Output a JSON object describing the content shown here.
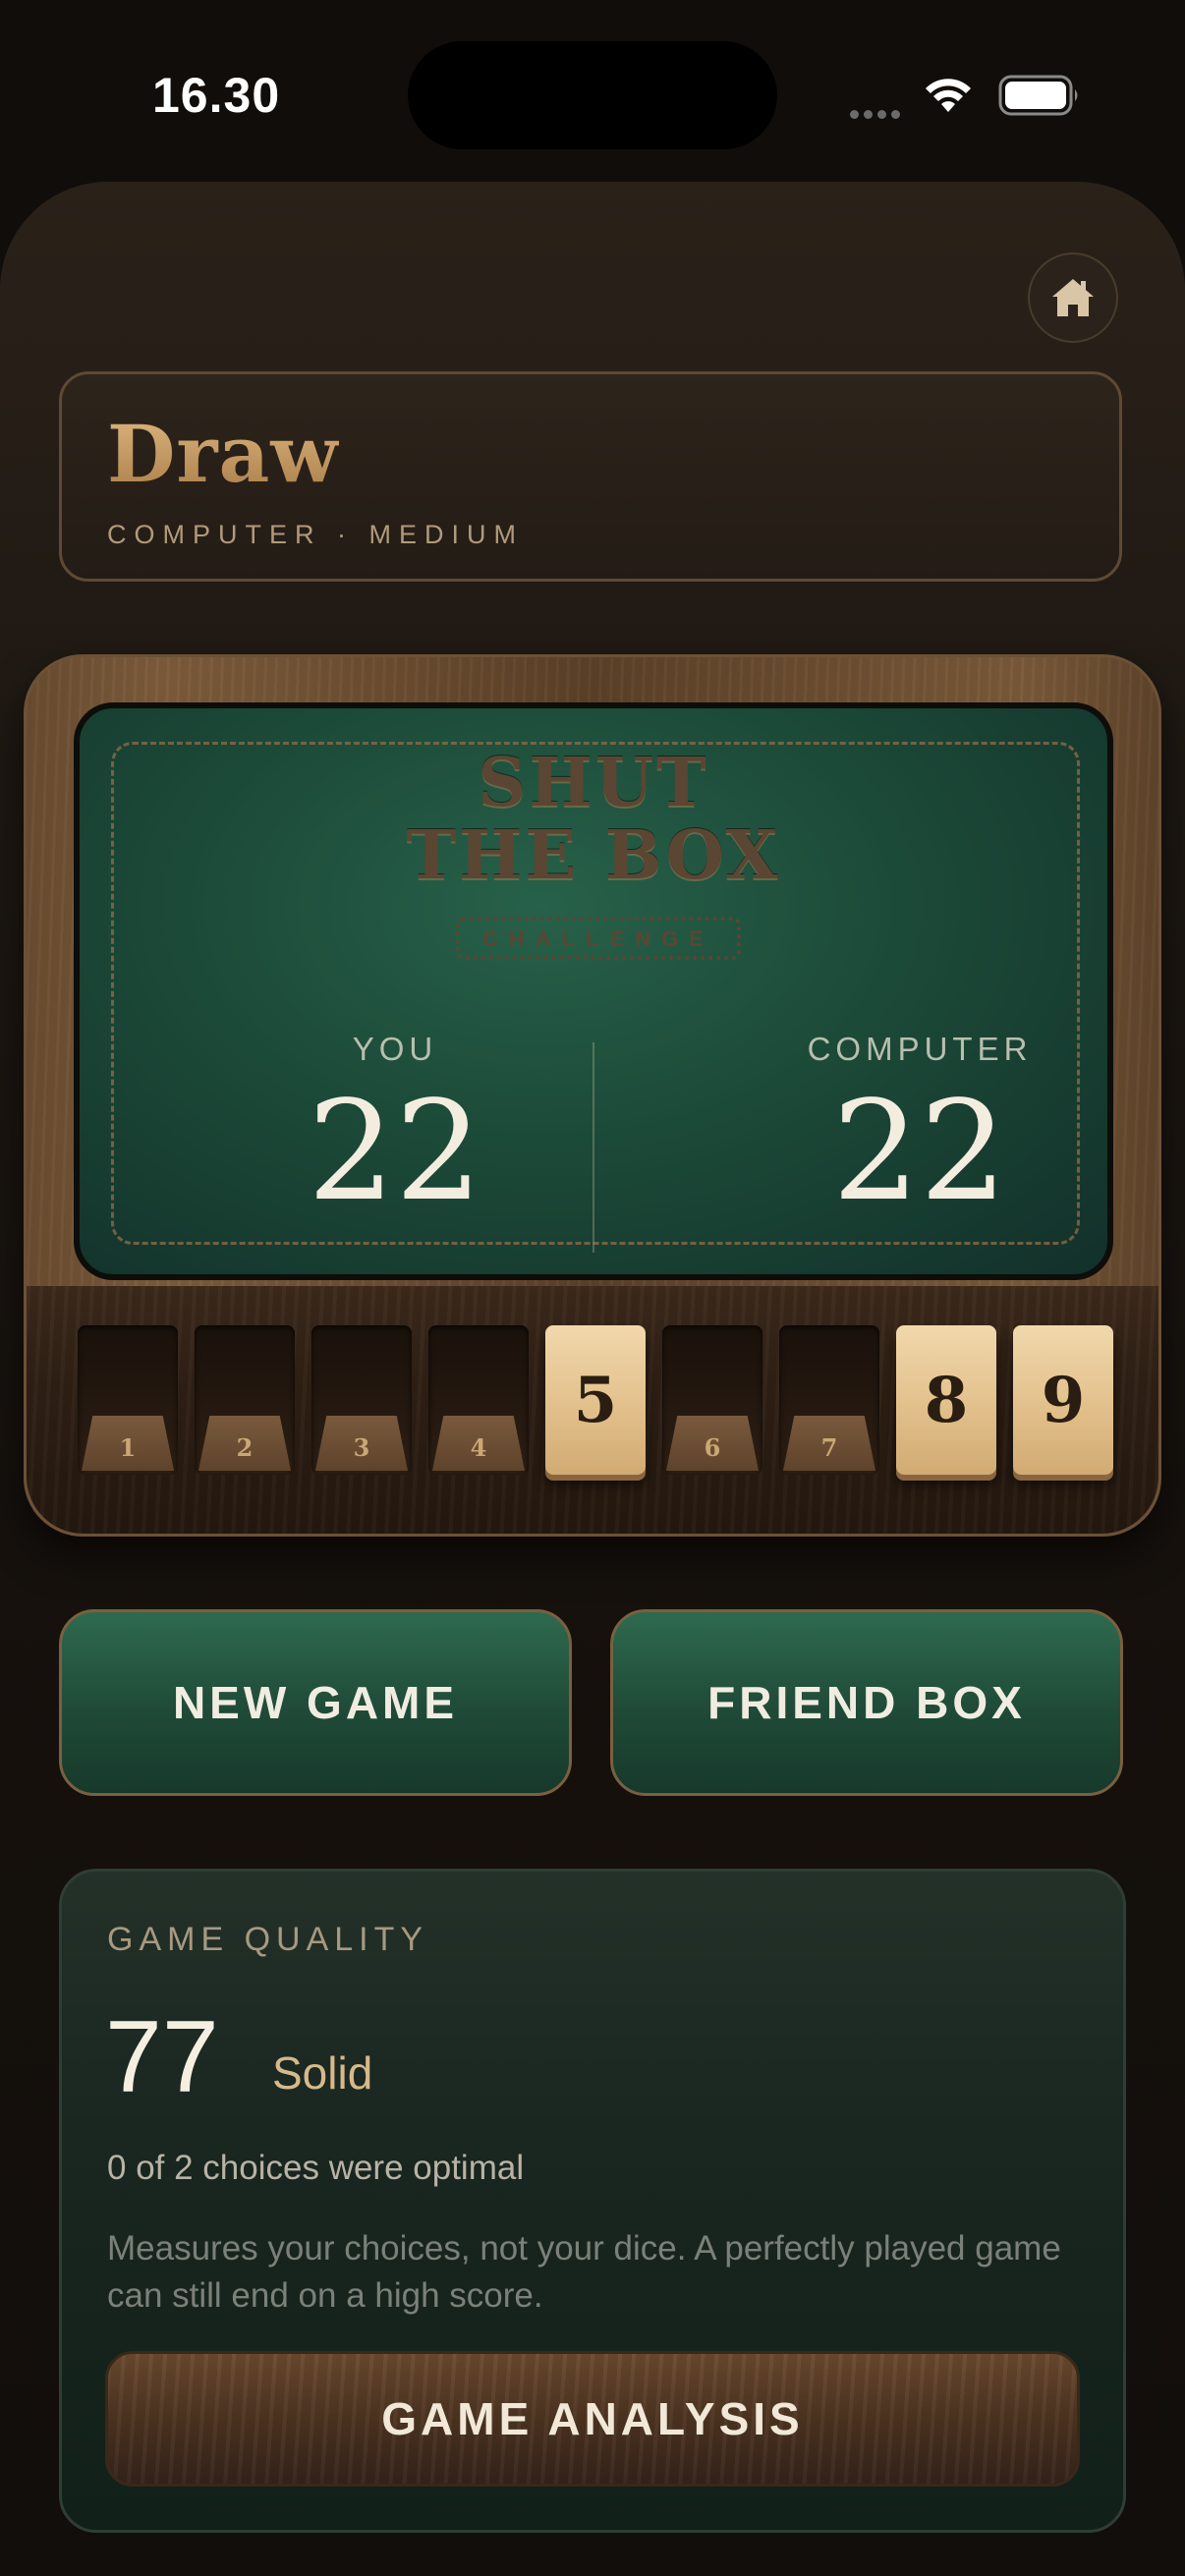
{
  "status_bar": {
    "time": "16.30"
  },
  "result": {
    "title": "Draw",
    "subtitle": "COMPUTER · MEDIUM"
  },
  "box": {
    "logo_line1": "SHUT",
    "logo_line2": "THE BOX",
    "logo_badge": "CHALLENGE",
    "players": [
      {
        "label": "YOU",
        "score": "22"
      },
      {
        "label": "COMPUTER",
        "score": "22"
      }
    ],
    "tiles": [
      {
        "number": "1",
        "state": "down"
      },
      {
        "number": "2",
        "state": "down"
      },
      {
        "number": "3",
        "state": "down"
      },
      {
        "number": "4",
        "state": "down"
      },
      {
        "number": "5",
        "state": "up"
      },
      {
        "number": "6",
        "state": "down"
      },
      {
        "number": "7",
        "state": "down"
      },
      {
        "number": "8",
        "state": "up"
      },
      {
        "number": "9",
        "state": "up"
      }
    ]
  },
  "actions": {
    "new_game": "NEW GAME",
    "friend_box": "FRIEND BOX"
  },
  "quality": {
    "label": "GAME QUALITY",
    "score": "77",
    "rating": "Solid",
    "optimal": "0 of 2 choices were optimal",
    "note": "Measures your choices, not your dice. A perfectly played game can still end on a high score.",
    "analysis_button": "GAME ANALYSIS"
  },
  "icons": {
    "home": "home-icon",
    "wifi": "wifi-icon",
    "battery": "battery-icon",
    "signal": "signal-icon"
  }
}
